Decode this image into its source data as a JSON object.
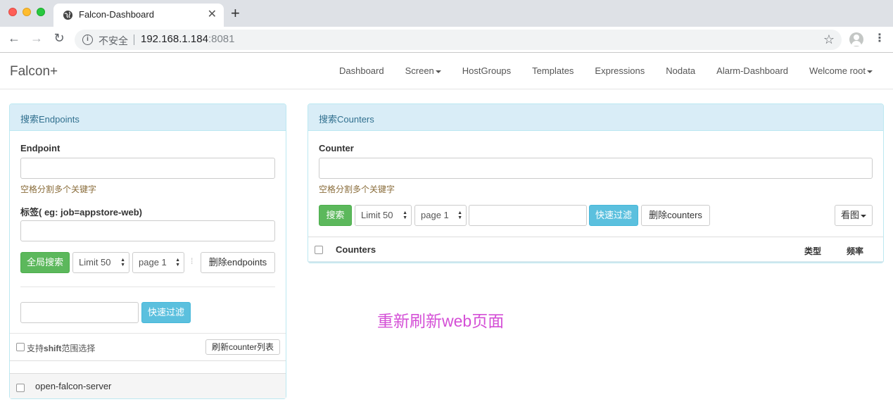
{
  "browser": {
    "tab_title": "Falcon-Dashboard",
    "tab_close": "✕",
    "new_tab": "+",
    "insecure_label": "不安全",
    "url_host": "192.168.1.184",
    "url_port": ":8081"
  },
  "navbar": {
    "brand": "Falcon+",
    "links": [
      "Dashboard",
      "Screen",
      "HostGroups",
      "Templates",
      "Expressions",
      "Nodata",
      "Alarm-Dashboard",
      "Welcome root"
    ]
  },
  "endpoints_panel": {
    "heading": "搜索Endpoints",
    "endpoint_label": "Endpoint",
    "endpoint_help": "空格分割多个关键字",
    "tag_label": "标签( eg: job=appstore-web)",
    "global_search_btn": "全局搜索",
    "limit_select": "Limit 50",
    "page_select": "page 1",
    "delete_btn": "删除endpoints",
    "filter_btn": "快速过滤",
    "shift_prefix": "支持",
    "shift_bold": "shift",
    "shift_suffix": "范围选择",
    "refresh_btn": "刷新counter列表",
    "list": [
      "open-falcon-server"
    ]
  },
  "counters_panel": {
    "heading": "搜索Counters",
    "counter_label": "Counter",
    "counter_help": "空格分割多个关键字",
    "search_btn": "搜索",
    "limit_select": "Limit 50",
    "page_select": "page 1",
    "filter_btn": "快速过滤",
    "delete_btn": "删除counters",
    "view_btn": "看图",
    "table": {
      "col_counters": "Counters",
      "col_type": "类型",
      "col_freq": "频率"
    }
  },
  "annotation": "重新刷新web页面"
}
